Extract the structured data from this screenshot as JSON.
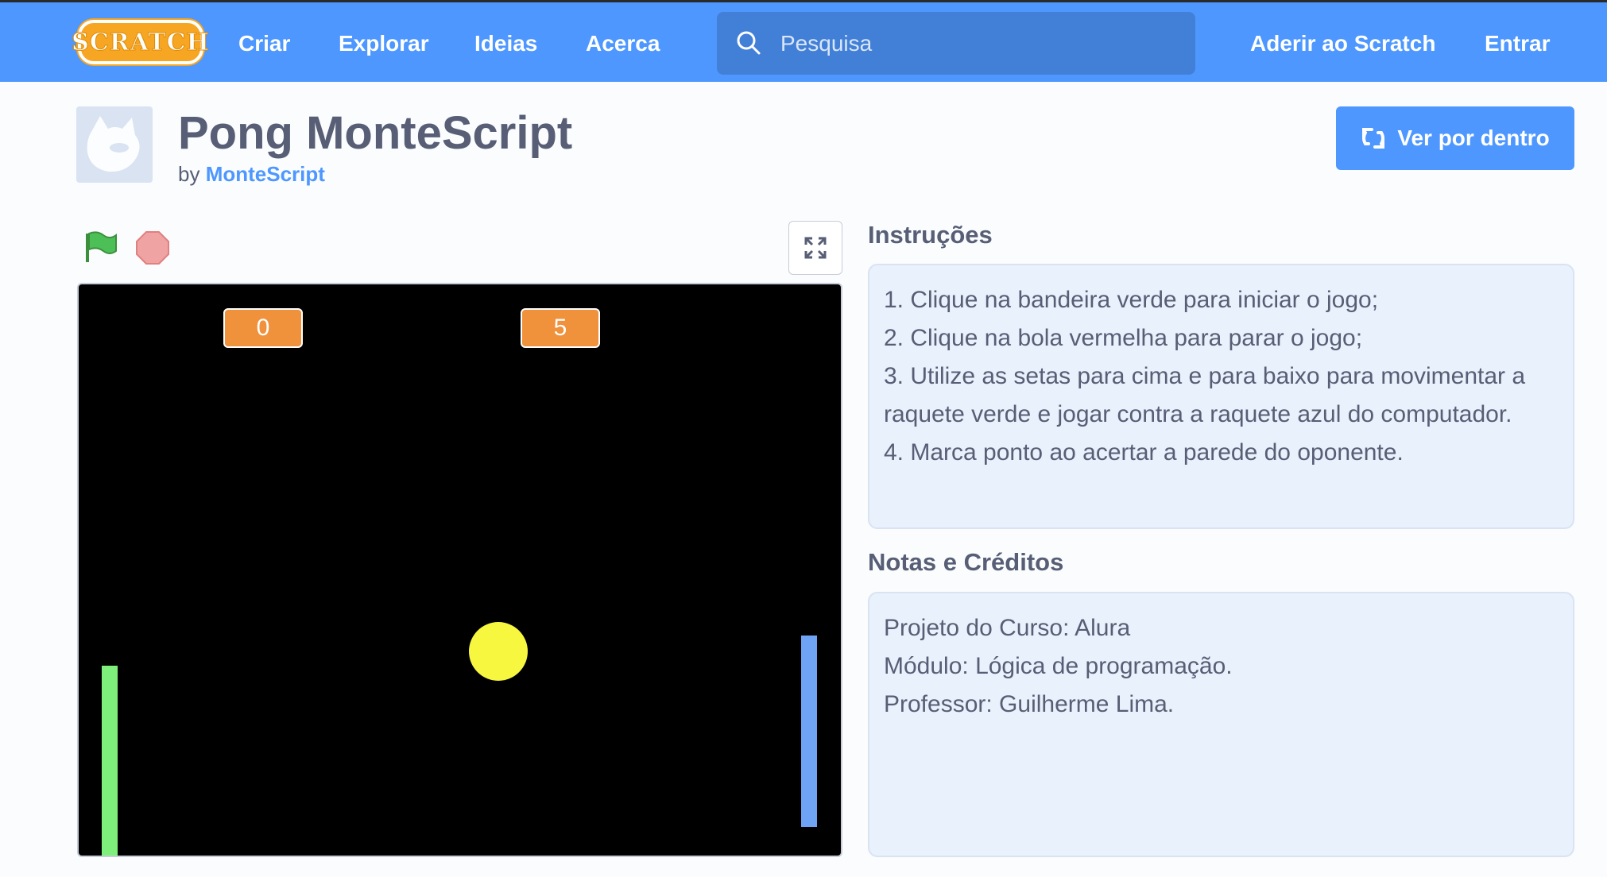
{
  "nav": {
    "logo": "SCRATCH",
    "links": [
      "Criar",
      "Explorar",
      "Ideias",
      "Acerca"
    ],
    "search_placeholder": "Pesquisa",
    "join": "Aderir ao Scratch",
    "signin": "Entrar"
  },
  "project": {
    "title": "Pong MonteScript",
    "by": "by",
    "author": "MonteScript",
    "see_inside": "Ver por dentro"
  },
  "stage": {
    "score_left": "0",
    "score_right": "5"
  },
  "instructions": {
    "heading": "Instruções",
    "lines": [
      "1. Clique na bandeira verde para iniciar o jogo;",
      "2. Clique na bola vermelha para parar o jogo;",
      "3. Utilize as setas para cima e para baixo para movimentar a raquete verde e jogar contra a raquete azul do computador.",
      "4. Marca ponto ao acertar a parede do oponente."
    ]
  },
  "notes": {
    "heading": "Notas e Créditos",
    "lines": [
      "Projeto do Curso: Alura",
      "Módulo: Lógica de programação.",
      "Professor: Guilherme Lima."
    ]
  },
  "colors": {
    "nav": "#4d97ff",
    "accent": "#4d97ff",
    "score_bg": "#f0913c",
    "paddle_left": "#7eef7b",
    "paddle_right": "#6ea3f5",
    "ball": "#f7f740"
  },
  "icons": {
    "search": "search-icon",
    "see_inside": "remix-icon",
    "flag": "green-flag-icon",
    "stop": "stop-sign-icon",
    "fullscreen": "fullscreen-icon"
  }
}
